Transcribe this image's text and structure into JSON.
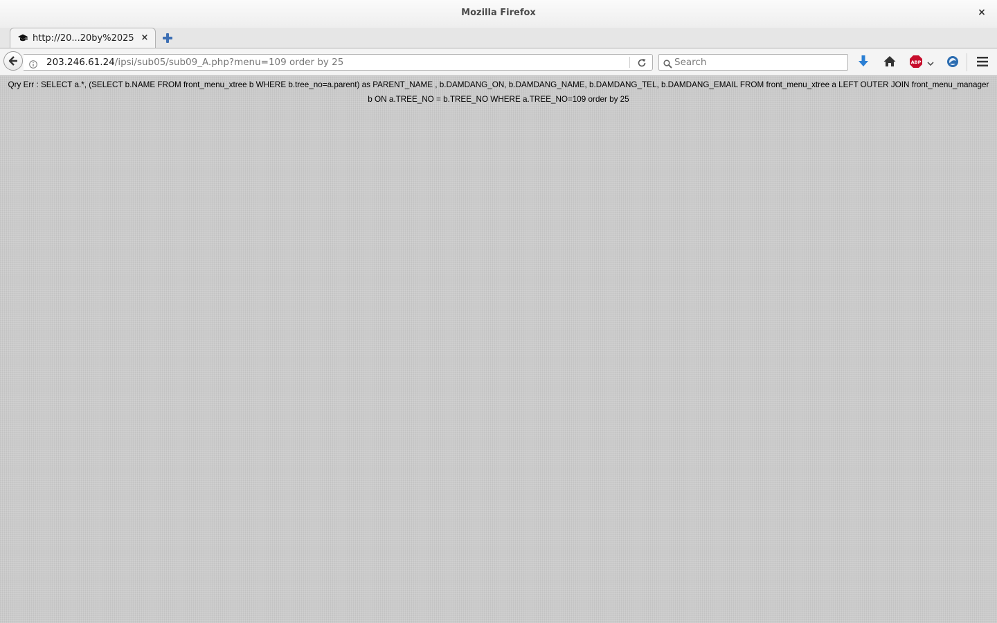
{
  "window": {
    "title": "Mozilla Firefox",
    "close_glyph": "×"
  },
  "tabs": [
    {
      "title": "http://20...20by%2025",
      "icon": "graduation-cap-icon",
      "close_glyph": "×"
    }
  ],
  "navbar": {
    "url_host": "203.246.61.24",
    "url_path": "/ipsi/sub05/sub09_A.php?menu=109 order by 25",
    "search_placeholder": "Search",
    "toolbar_icons": [
      "download-icon",
      "home-icon",
      "adblock-plus-icon",
      "sync-icon",
      "hamburger-menu-icon"
    ]
  },
  "page": {
    "error_text": "Qry Err : SELECT a.*, (SELECT b.NAME FROM front_menu_xtree b WHERE b.tree_no=a.parent) as PARENT_NAME , b.DAMDANG_ON, b.DAMDANG_NAME, b.DAMDANG_TEL, b.DAMDANG_EMAIL FROM front_menu_xtree a LEFT OUTER JOIN front_menu_manager b ON a.TREE_NO = b.TREE_NO WHERE a.TREE_NO=109 order by 25"
  },
  "colors": {
    "page_background": "#cbcbcb",
    "abp_red": "#c70d2c",
    "download_blue": "#2a7fd4"
  }
}
